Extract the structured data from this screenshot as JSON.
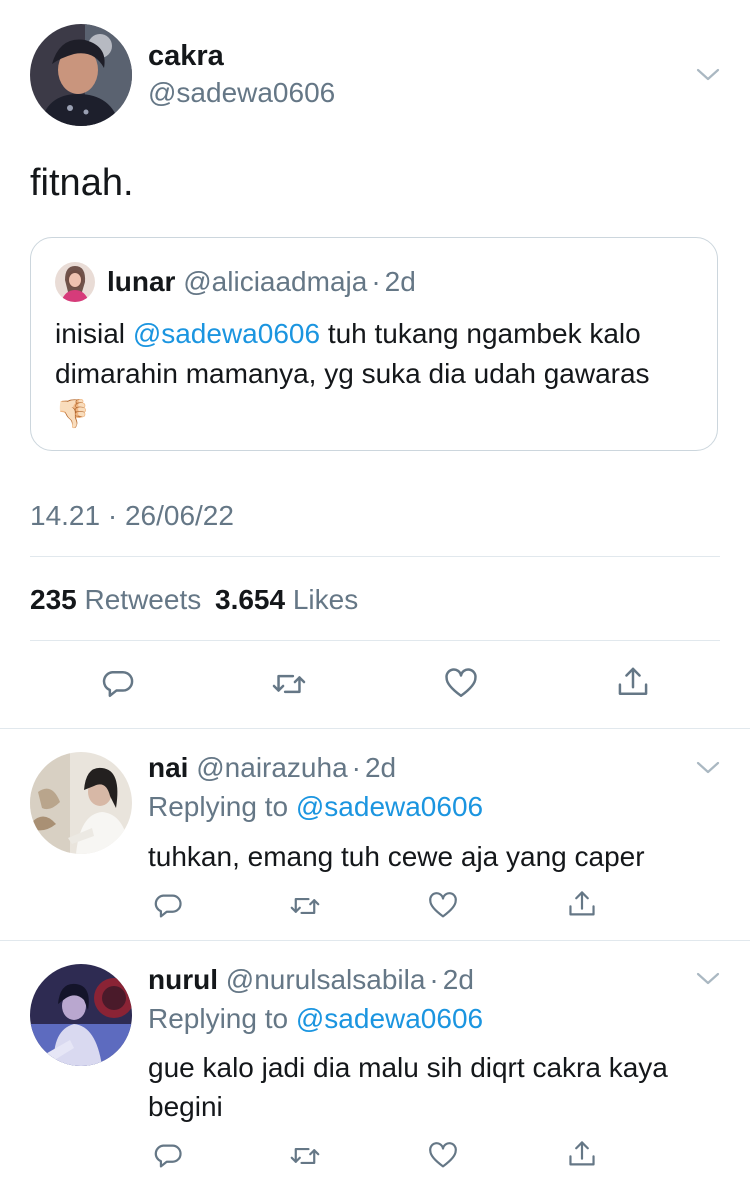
{
  "main_tweet": {
    "display_name": "cakra",
    "handle": "@sadewa0606",
    "text": "fitnah.",
    "quoted": {
      "display_name": "lunar",
      "handle": "@aliciaadmaja",
      "separator": "·",
      "time": "2d",
      "text_before": "inisial ",
      "mention": "@sadewa0606",
      "text_after": " tuh tukang ngambek kalo dimarahin mamanya, yg suka dia udah gawaras",
      "emoji": "👎🏻"
    },
    "timestamp": "14.21 · 26/06/22",
    "retweets_count": "235",
    "retweets_label": "Retweets",
    "likes_count": "3.654",
    "likes_label": "Likes"
  },
  "replies": [
    {
      "display_name": "nai",
      "handle": "@nairazuha",
      "separator": "·",
      "time": "2d",
      "replying_label": "Replying to",
      "replying_handle": "@sadewa0606",
      "text": "tuhkan, emang tuh cewe aja yang caper"
    },
    {
      "display_name": "nurul",
      "handle": "@nurulsalsabila",
      "separator": "·",
      "time": "2d",
      "replying_label": "Replying to",
      "replying_handle": "@sadewa0606",
      "text": "gue kalo jadi dia malu sih diqrt cakra kaya begini"
    }
  ],
  "icons": {
    "reply": "reply-icon",
    "retweet": "retweet-icon",
    "like": "heart-icon",
    "share": "share-icon",
    "menu": "chevron-down-icon"
  },
  "colors": {
    "text": "#14171a",
    "secondary": "#657786",
    "link": "#1b95e0",
    "border": "#e1e8ed"
  }
}
